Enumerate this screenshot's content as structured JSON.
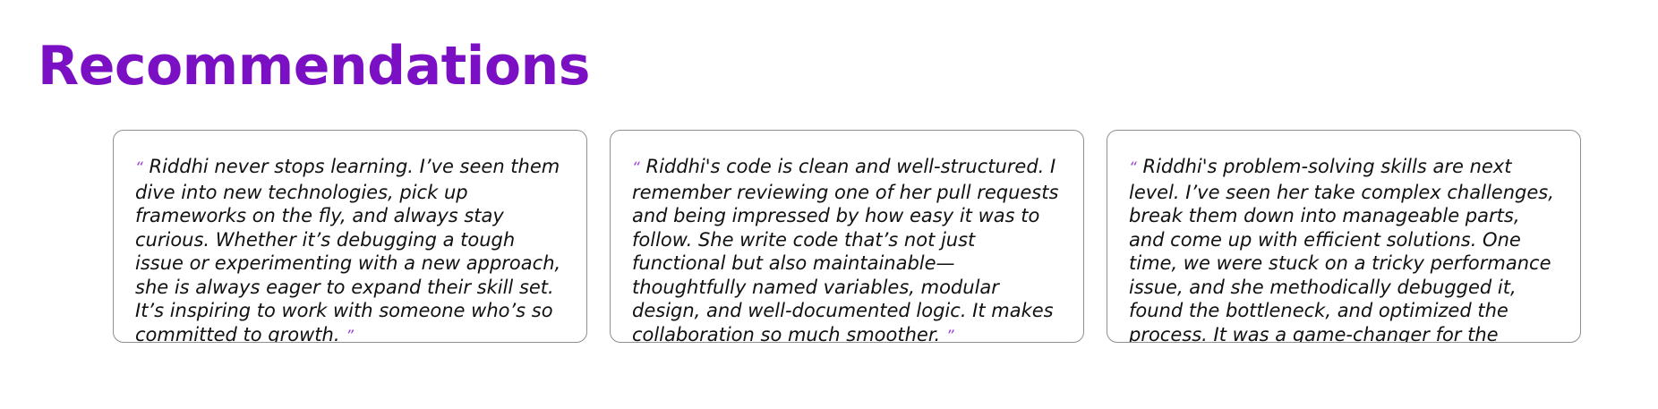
{
  "section": {
    "title": "Recommendations"
  },
  "quote_marks": {
    "open": "“",
    "close": "”"
  },
  "recommendations": [
    {
      "text": "Riddhi never stops learning. I’ve seen them dive into new technologies, pick up frameworks on the fly, and always stay curious. Whether it’s debugging a tough issue or experimenting with a new approach, she is always eager to expand their skill set. It’s inspiring to work with someone who’s so committed to growth."
    },
    {
      "text": "Riddhi's code is clean and well-structured. I remember reviewing one of her pull requests and being impressed by how easy it was to follow. She write code that’s not just functional but also maintainable—thoughtfully named variables, modular design, and well-documented logic. It makes collaboration so much smoother."
    },
    {
      "text": "Riddhi's problem-solving skills are next level. I’ve seen her take complex challenges, break them down into manageable parts, and come up with efficient solutions. One time, we were stuck on a tricky performance issue, and she methodically debugged it, found the bottleneck, and optimized the process. It was a game-changer for the project."
    }
  ],
  "colors": {
    "title": "#7b0fc4",
    "quote_mark": "#9b3ed3",
    "card_border": "#8f8f8f",
    "text": "#111111"
  }
}
